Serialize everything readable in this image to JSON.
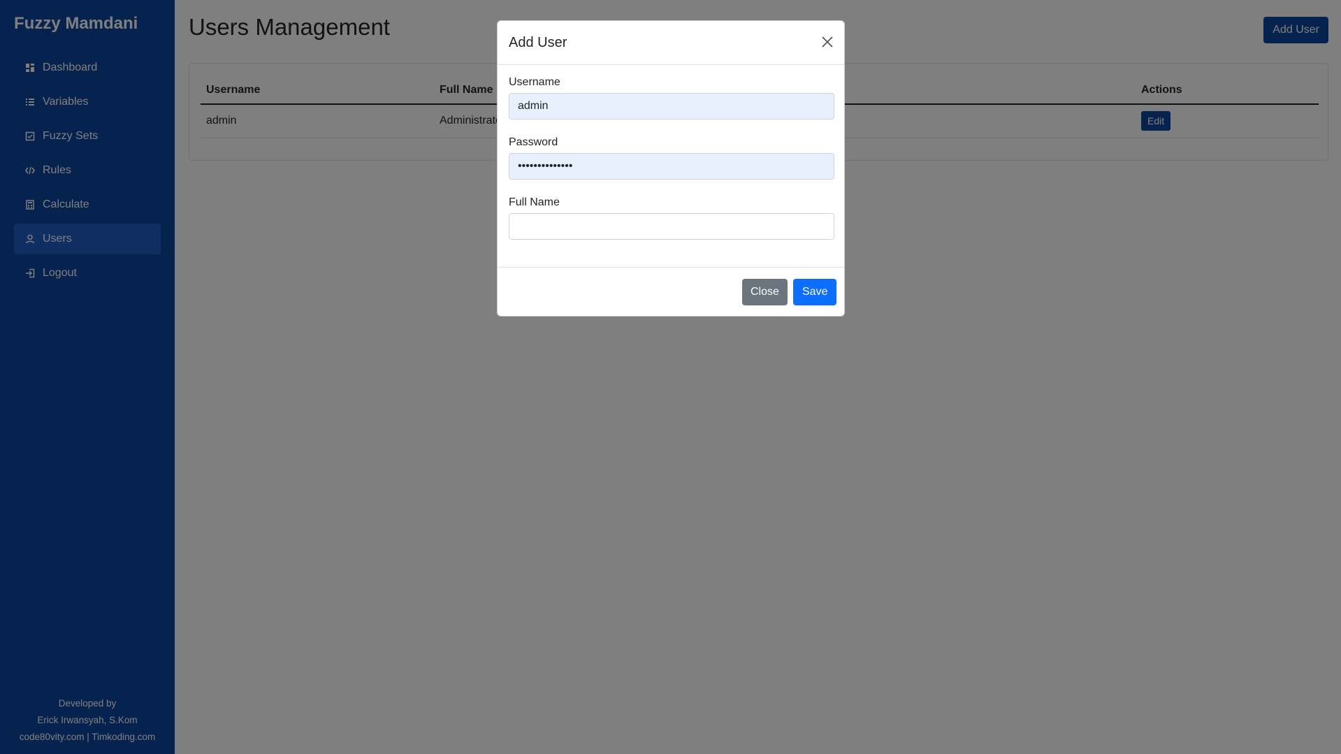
{
  "sidebar": {
    "brand": "Fuzzy Mamdani",
    "items": [
      {
        "label": "Dashboard",
        "icon": "dashboard-icon"
      },
      {
        "label": "Variables",
        "icon": "list-icon"
      },
      {
        "label": "Fuzzy Sets",
        "icon": "square-check-icon"
      },
      {
        "label": "Rules",
        "icon": "code-icon"
      },
      {
        "label": "Calculate",
        "icon": "calculator-icon"
      },
      {
        "label": "Users",
        "icon": "user-icon",
        "active": true
      },
      {
        "label": "Logout",
        "icon": "logout-icon"
      }
    ],
    "footer": {
      "line1": "Developed by",
      "line2": "Erick Irwansyah, S.Kom",
      "line3": "code80vity.com | Timkoding.com"
    }
  },
  "header": {
    "title": "Users Management",
    "add_user_label": "Add User"
  },
  "table": {
    "columns": [
      "Username",
      "Full Name",
      "Actions"
    ],
    "rows": [
      {
        "username": "admin",
        "full_name": "Administrator",
        "action_label": "Edit"
      }
    ]
  },
  "modal": {
    "title": "Add User",
    "username_label": "Username",
    "username_value": "admin",
    "password_label": "Password",
    "password_value": "••••••••••••••",
    "full_name_label": "Full Name",
    "full_name_value": "",
    "close_label": "Close",
    "save_label": "Save"
  },
  "colors": {
    "sidebar_bg": "#0d47a1",
    "primary": "#0d6efd",
    "secondary": "#6c757d"
  }
}
